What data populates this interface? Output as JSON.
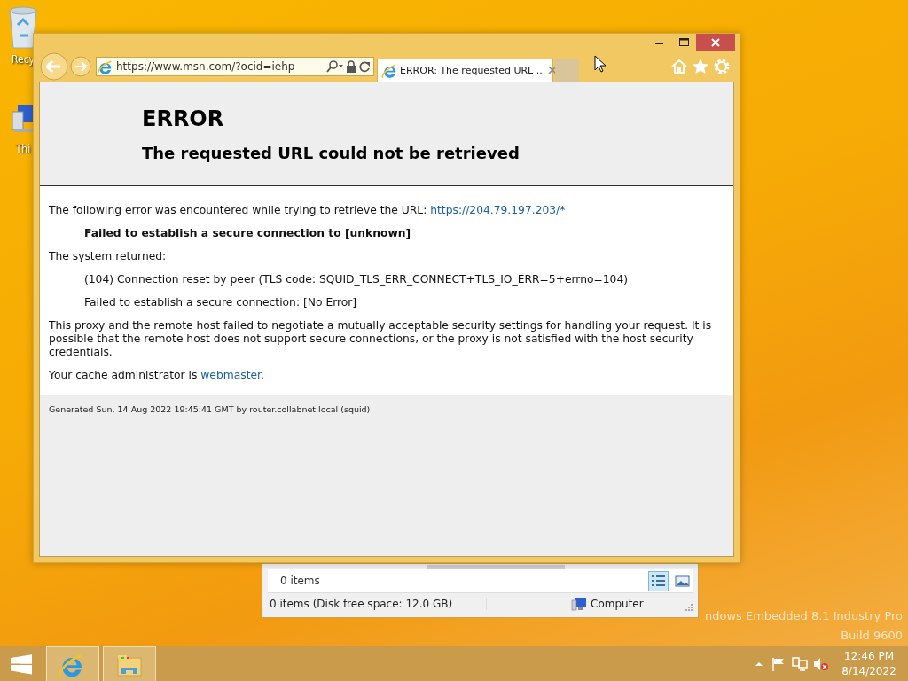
{
  "desktop": {
    "icons": [
      {
        "kind": "recycle",
        "label": "Recy"
      },
      {
        "kind": "pc",
        "label": "Thi"
      }
    ],
    "edition": [
      "ndows Embedded 8.1 Industry Pro",
      "Build 9600"
    ]
  },
  "explorer": {
    "item_count": "0 items",
    "views": [
      {
        "kind": "details",
        "selected": true
      },
      {
        "kind": "tiles",
        "selected": false
      }
    ],
    "status": "0 items (Disk free space: 12.0 GB)",
    "location": "Computer"
  },
  "browser": {
    "address": "https://www.msn.com/?ocid=iehp",
    "tabs": [
      {
        "title": "ERROR: The requested URL ...",
        "selected": true
      }
    ],
    "page": {
      "title": "ERROR",
      "subtitle": "The requested URL could not be retrieved",
      "blocks": [
        {
          "kind": "para",
          "text": "The following error was encountered while trying to retrieve the URL: ",
          "link": "https://204.79.197.203/*"
        },
        {
          "kind": "bold_quote",
          "text": "Failed to establish a secure connection to [unknown]"
        },
        {
          "kind": "para",
          "text": "The system returned:"
        },
        {
          "kind": "quote",
          "text": "(104) Connection reset by peer (TLS code: SQUID_TLS_ERR_CONNECT+TLS_IO_ERR=5+errno=104)"
        },
        {
          "kind": "quote",
          "text": "Failed to establish a secure connection: [No Error]"
        },
        {
          "kind": "para",
          "text": "This proxy and the remote host failed to negotiate a mutually acceptable security settings for handling your request. It is possible that the remote host does not support secure connections, or the proxy is not satisfied with the host security credentials."
        },
        {
          "kind": "para",
          "text": "Your cache administrator is ",
          "link": "webmaster",
          "tail": "."
        }
      ],
      "footer": "Generated Sun, 14 Aug 2022 19:45:41 GMT by router.collabnet.local (squid)"
    }
  },
  "taskbar": {
    "apps": [
      {
        "kind": "ie"
      },
      {
        "kind": "explorer"
      }
    ],
    "clock": {
      "time": "12:46 PM",
      "date": "8/14/2022"
    }
  }
}
